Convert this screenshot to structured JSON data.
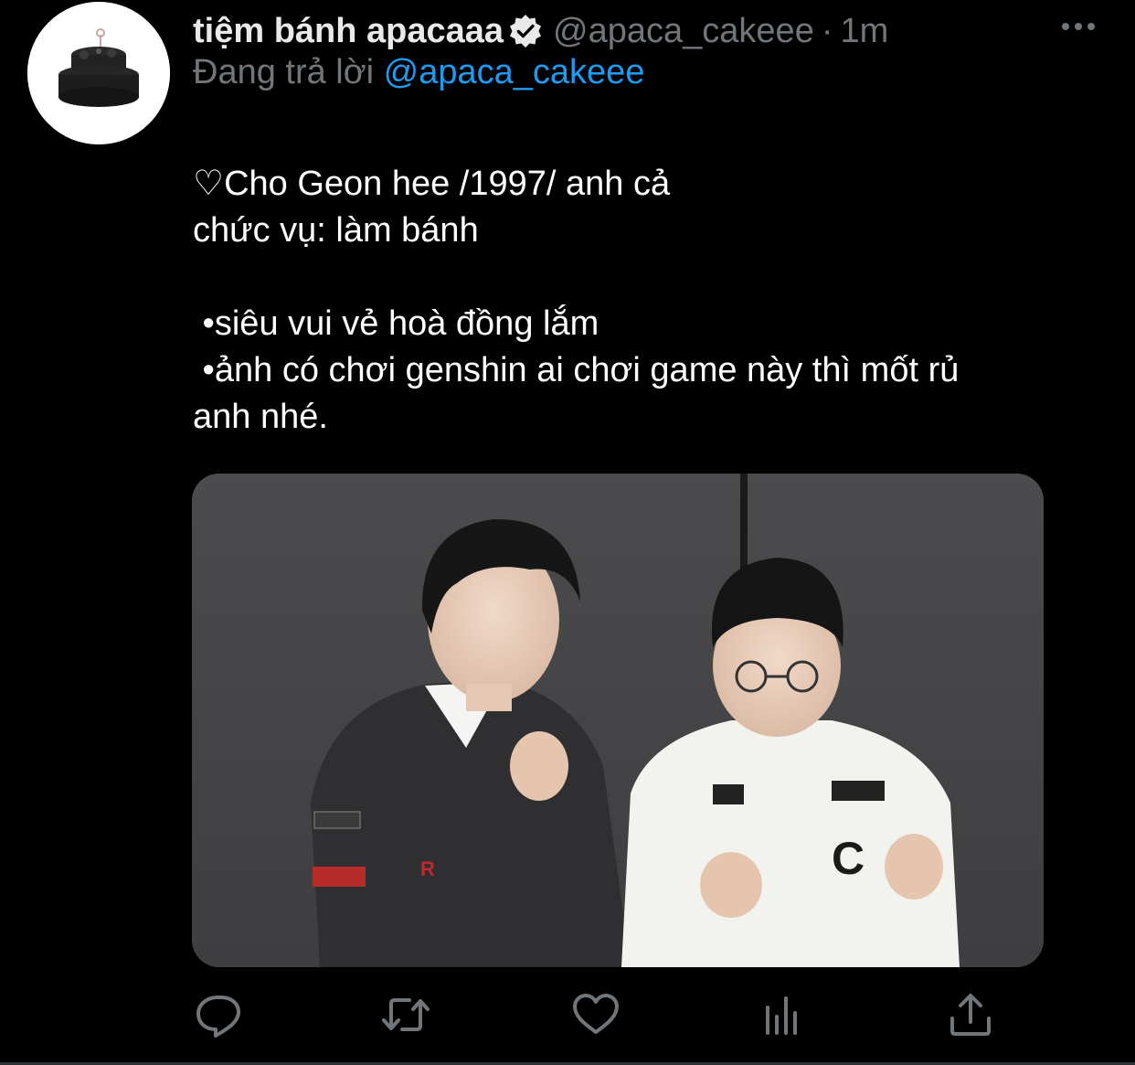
{
  "tweet": {
    "display_name": "tiệm bánh apacaaa",
    "verified_icon": "verified-badge-icon",
    "handle": "@apaca_cakeee",
    "separator": "·",
    "time": "1m",
    "reply_prefix": "Đang trả lời",
    "reply_to": "@apaca_cakeee",
    "body_lines": [
      "♡Cho Geon hee /1997/ anh cả",
      "chức vụ: làm bánh",
      "",
      " •siêu vui vẻ hoà đồng lắm",
      " •ảnh có chơi genshin ai chơi game này thì mốt rủ",
      "anh nhé."
    ]
  },
  "icons": {
    "more": "more-dots-icon",
    "reply": "reply-icon",
    "retweet": "retweet-icon",
    "like": "heart-icon",
    "analytics": "analytics-icon",
    "share": "share-icon"
  },
  "colors": {
    "background": "#000000",
    "text": "#e7e9ea",
    "secondary": "#71767b",
    "link": "#1d9bf0"
  }
}
